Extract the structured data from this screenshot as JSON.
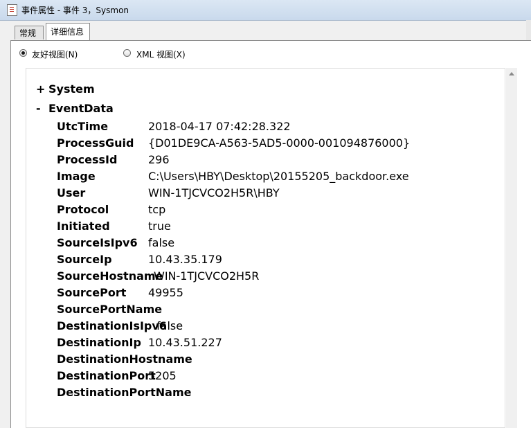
{
  "window": {
    "title": "事件属性 - 事件 3，Sysmon"
  },
  "tabs": [
    "常规",
    "详细信息"
  ],
  "view_options": {
    "friendly": "友好视图(N)",
    "xml": "XML 视图(X)",
    "selected": "friendly"
  },
  "sections": {
    "system": {
      "toggle": "+",
      "label": "System"
    },
    "eventdata": {
      "toggle": "-",
      "label": "EventData"
    }
  },
  "rows": [
    {
      "key": "UtcTime",
      "value": "2018-04-17 07:42:28.322"
    },
    {
      "key": "ProcessGuid",
      "value": "{D01DE9CA-A563-5AD5-0000-001094876000}"
    },
    {
      "key": "ProcessId",
      "value": "296"
    },
    {
      "key": "Image",
      "value": "C:\\Users\\HBY\\Desktop\\20155205_backdoor.exe"
    },
    {
      "key": "User",
      "value": "WIN-1TJCVCO2H5R\\HBY"
    },
    {
      "key": "Protocol",
      "value": "tcp"
    },
    {
      "key": "Initiated",
      "value": "true"
    },
    {
      "key": "SourceIsIpv6",
      "value": "false"
    },
    {
      "key": "SourceIp",
      "value": "10.43.35.179"
    },
    {
      "key": "SourceHostname",
      "value": "WIN-1TJCVCO2H5R"
    },
    {
      "key": "SourcePort",
      "value": "49955"
    },
    {
      "key": "SourcePortName",
      "value": ""
    },
    {
      "key": "DestinationIsIpv6",
      "value": "false"
    },
    {
      "key": "DestinationIp",
      "value": "10.43.51.227"
    },
    {
      "key": "DestinationHostname",
      "value": ""
    },
    {
      "key": "DestinationPort",
      "value": "5205"
    },
    {
      "key": "DestinationPortName",
      "value": ""
    }
  ]
}
